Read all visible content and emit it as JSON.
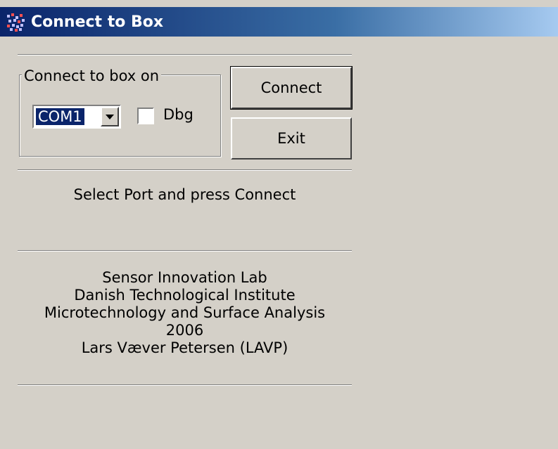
{
  "window": {
    "title": "Connect to Box"
  },
  "connection": {
    "group_label": "Connect to box on",
    "port_value": "COM1",
    "debug_label": "Dbg",
    "debug_checked": false
  },
  "buttons": {
    "connect": "Connect",
    "exit": "Exit"
  },
  "status": "Select Port and press Connect",
  "credits": {
    "line1": "Sensor Innovation Lab",
    "line2": "Danish Technological Institute",
    "line3": "Microtechnology and Surface Analysis",
    "line4": "2006",
    "line5": "Lars Væver Petersen (LAVP)"
  },
  "colors": {
    "title_bar": "#0a246a",
    "dialog_bg": "#d4d0c8",
    "selection": "#0a246a"
  },
  "icons": {
    "app": "grid-app-icon",
    "dropdown": "chevron-down-icon"
  }
}
